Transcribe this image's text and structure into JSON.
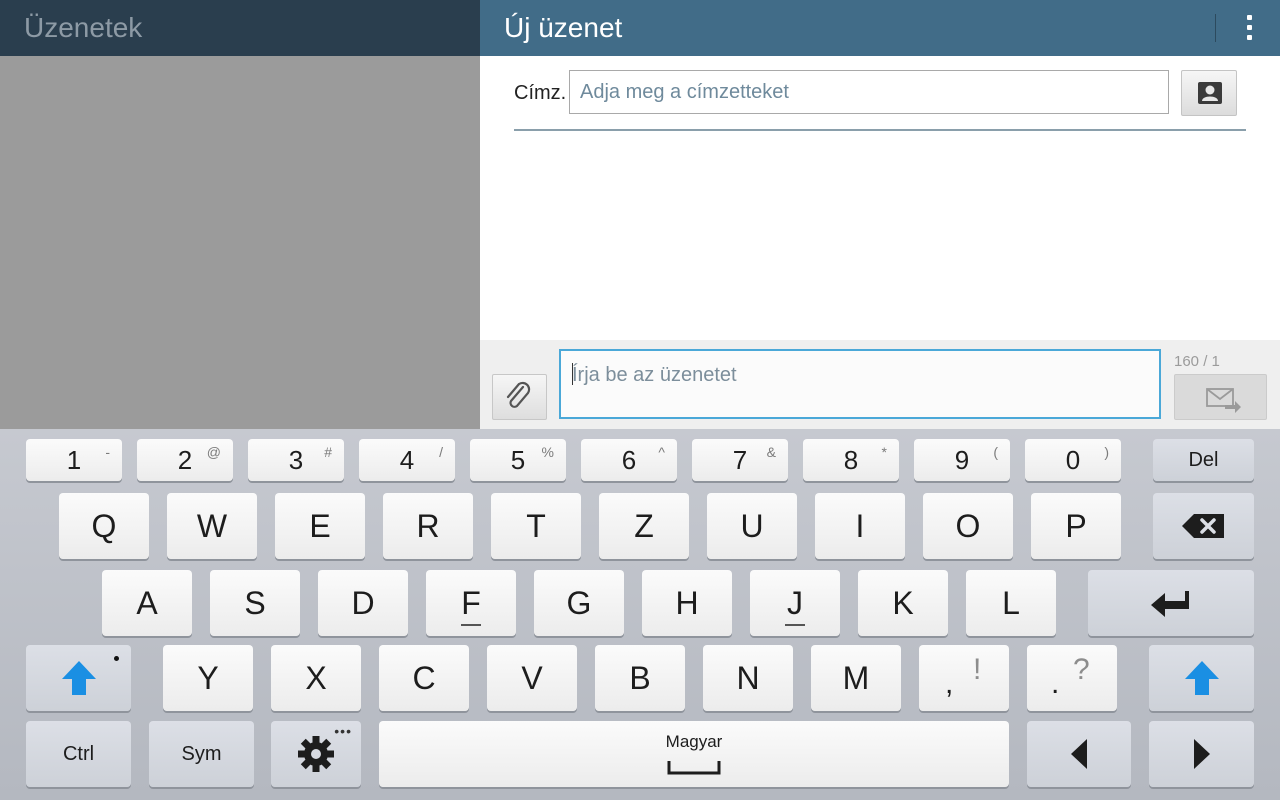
{
  "left_pane": {
    "title": "Üzenetek"
  },
  "right_pane": {
    "title": "Új üzenet",
    "recipient_label": "Címz.",
    "recipient_placeholder": "Adja meg a címzetteket",
    "message_placeholder": "Írja be az üzenetet",
    "char_counter": "160 / 1"
  },
  "keyboard": {
    "number_row": [
      {
        "main": "1",
        "alt": "-"
      },
      {
        "main": "2",
        "alt": "@"
      },
      {
        "main": "3",
        "alt": "#"
      },
      {
        "main": "4",
        "alt": "/"
      },
      {
        "main": "5",
        "alt": "%"
      },
      {
        "main": "6",
        "alt": "^"
      },
      {
        "main": "7",
        "alt": "&"
      },
      {
        "main": "8",
        "alt": "*"
      },
      {
        "main": "9",
        "alt": "("
      },
      {
        "main": "0",
        "alt": ")"
      }
    ],
    "del_label": "Del",
    "row1": [
      "Q",
      "W",
      "E",
      "R",
      "T",
      "Z",
      "U",
      "I",
      "O",
      "P"
    ],
    "row2": [
      "A",
      "S",
      "D",
      "F",
      "G",
      "H",
      "J",
      "K",
      "L"
    ],
    "row3": [
      "Y",
      "X",
      "C",
      "V",
      "B",
      "N",
      "M"
    ],
    "comma_key": {
      "main": ",",
      "alt": "!"
    },
    "period_key": {
      "main": ".",
      "alt": "?"
    },
    "ctrl_label": "Ctrl",
    "sym_label": "Sym",
    "language_label": "Magyar",
    "icons": {
      "backspace": "backspace-icon",
      "enter": "enter-icon",
      "shift": "shift-arrow-icon",
      "settings": "gear-icon",
      "left": "arrow-left-icon",
      "right": "arrow-right-icon",
      "space": "spacebar-icon"
    },
    "accent_color": "#1a8fe3"
  },
  "colors": {
    "left_header_bg": "#2a3e4e",
    "right_header_bg": "#416c88",
    "input_focus_border": "#4aa8d8"
  }
}
